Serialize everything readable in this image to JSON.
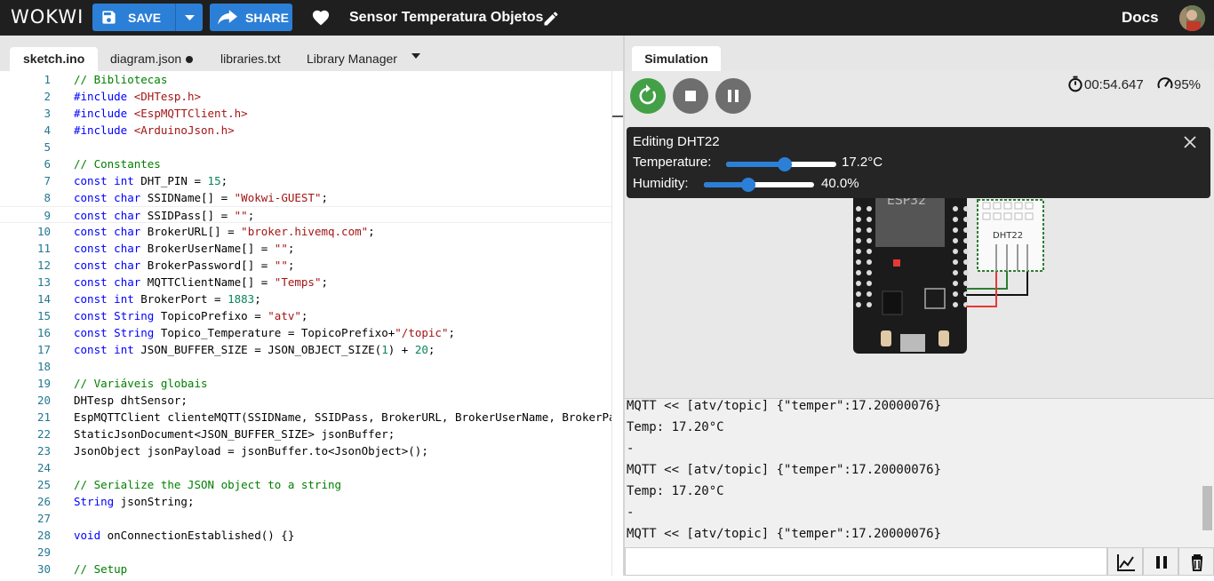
{
  "header": {
    "logo": "WOKWI",
    "save_label": "SAVE",
    "share_label": "SHARE",
    "project_title": "Sensor Temperatura Objetos",
    "docs_label": "Docs"
  },
  "editor": {
    "tabs": [
      {
        "label": "sketch.ino",
        "active": true
      },
      {
        "label": "diagram.json",
        "modified": true
      },
      {
        "label": "libraries.txt"
      },
      {
        "label": "Library Manager"
      }
    ],
    "lines": [
      {
        "n": "1",
        "t": "// Bibliotecas"
      },
      {
        "n": "2",
        "t": "#include <DHTesp.h>"
      },
      {
        "n": "3",
        "t": "#include <EspMQTTClient.h>"
      },
      {
        "n": "4",
        "t": "#include <ArduinoJson.h>"
      },
      {
        "n": "5",
        "t": ""
      },
      {
        "n": "6",
        "t": "// Constantes"
      },
      {
        "n": "7",
        "t": "const int DHT_PIN = 15;"
      },
      {
        "n": "8",
        "t": "const char SSIDName[] = \"Wokwi-GUEST\";"
      },
      {
        "n": "9",
        "t": "const char SSIDPass[] = \"\";"
      },
      {
        "n": "10",
        "t": "const char BrokerURL[] = \"broker.hivemq.com\";"
      },
      {
        "n": "11",
        "t": "const char BrokerUserName[] = \"\";"
      },
      {
        "n": "12",
        "t": "const char BrokerPassword[] = \"\";"
      },
      {
        "n": "13",
        "t": "const char MQTTClientName[] = \"Temps\";"
      },
      {
        "n": "14",
        "t": "const int BrokerPort = 1883;"
      },
      {
        "n": "15",
        "t": "const String TopicoPrefixo = \"atv\";"
      },
      {
        "n": "16",
        "t": "const String Topico_Temperature = TopicoPrefixo+\"/topic\";"
      },
      {
        "n": "17",
        "t": "const int JSON_BUFFER_SIZE = JSON_OBJECT_SIZE(1) + 20;"
      },
      {
        "n": "18",
        "t": ""
      },
      {
        "n": "19",
        "t": "// Variáveis globais"
      },
      {
        "n": "20",
        "t": "DHTesp dhtSensor;"
      },
      {
        "n": "21",
        "t": "EspMQTTClient clienteMQTT(SSIDName, SSIDPass, BrokerURL, BrokerUserName, BrokerPa"
      },
      {
        "n": "22",
        "t": "StaticJsonDocument<JSON_BUFFER_SIZE> jsonBuffer;"
      },
      {
        "n": "23",
        "t": "JsonObject jsonPayload = jsonBuffer.to<JsonObject>();"
      },
      {
        "n": "24",
        "t": ""
      },
      {
        "n": "25",
        "t": "// Serialize the JSON object to a string"
      },
      {
        "n": "26",
        "t": "String jsonString;"
      },
      {
        "n": "27",
        "t": ""
      },
      {
        "n": "28",
        "t": "void onConnectionEstablished() {}"
      },
      {
        "n": "29",
        "t": ""
      },
      {
        "n": "30",
        "t": "// Setup"
      }
    ]
  },
  "simulation": {
    "tab_label": "Simulation",
    "timer": "00:54.647",
    "speed": "95%",
    "editor_panel": {
      "title": "Editing DHT22",
      "temperature_label": "Temperature:",
      "temperature_value": "17.2°C",
      "temperature_fraction": 0.53,
      "humidity_label": "Humidity:",
      "humidity_value": "40.0%",
      "humidity_fraction": 0.4
    },
    "board_label": "ESP32",
    "sensor_label": "DHT22"
  },
  "serial": {
    "lines": [
      "MQTT << [atv/topic] {\"temper\":17.20000076}",
      "Temp: 17.20°C",
      "-",
      "MQTT << [atv/topic] {\"temper\":17.20000076}",
      "Temp: 17.20°C",
      "-",
      "MQTT << [atv/topic] {\"temper\":17.20000076}"
    ]
  },
  "colors": {
    "accent": "#2c7fd6",
    "restart": "#4caf50",
    "control": "#6e6e6e",
    "topbar": "#1f1f1f"
  }
}
